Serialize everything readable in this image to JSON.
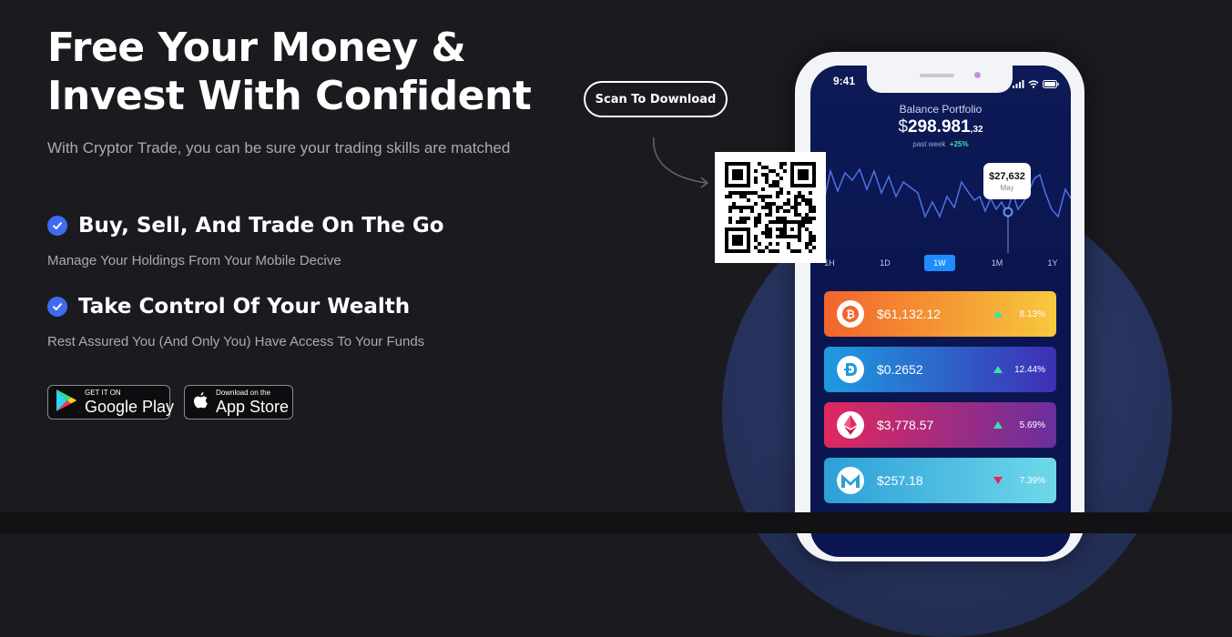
{
  "hero": {
    "headline_line1": "Free Your Money &",
    "headline_line2": "Invest With Confident",
    "subtitle": "With Cryptor Trade, you can be sure your trading skills are matched"
  },
  "features": [
    {
      "title": "Buy, Sell, And Trade On The Go",
      "desc": "Manage Your Holdings From Your Mobile Decive",
      "icon": "check-circle-icon"
    },
    {
      "title": "Take Control Of Your Wealth",
      "desc": "Rest Assured You (And Only You) Have Access To Your Funds",
      "icon": "check-circle-icon"
    }
  ],
  "stores": {
    "google": {
      "small": "GET IT ON",
      "big": "Google Play"
    },
    "apple": {
      "small": "Download on the",
      "big": "App Store"
    }
  },
  "scan": {
    "label": "Scan To Download"
  },
  "phone": {
    "time": "9:41",
    "balance_label": "Balance Portfolio",
    "currency": "$",
    "balance_main": "298.981",
    "balance_cents": ",32",
    "period": "past week",
    "period_change": "+25%",
    "tooltip_value": "$27,632",
    "tooltip_month": "May",
    "ranges": [
      "1H",
      "1D",
      "1W",
      "1M",
      "1Y"
    ],
    "active_range": "1W",
    "coins": [
      {
        "name": "bitcoin",
        "price": "$61,132.12",
        "change": "8.13%",
        "direction": "up",
        "icon": "bitcoin-icon",
        "gradient": [
          "#f2642b",
          "#f7c93d"
        ]
      },
      {
        "name": "dogecoin",
        "price": "$0.2652",
        "change": "12.44%",
        "direction": "up",
        "icon": "dogecoin-icon",
        "gradient": [
          "#1e9be0",
          "#3d2fb3"
        ]
      },
      {
        "name": "ethereum",
        "price": "$3,778.57",
        "change": "5.69%",
        "direction": "up",
        "icon": "ethereum-icon",
        "gradient": [
          "#e0285e",
          "#6b2f9e"
        ]
      },
      {
        "name": "monero",
        "price": "$257.18",
        "change": "7.39%",
        "direction": "down",
        "icon": "monero-icon",
        "gradient": [
          "#2c9fd7",
          "#6fd8ea"
        ]
      }
    ],
    "colors": {
      "up": "#3ee0a8",
      "down": "#e5245c",
      "active_range": "#1f8cff"
    }
  }
}
